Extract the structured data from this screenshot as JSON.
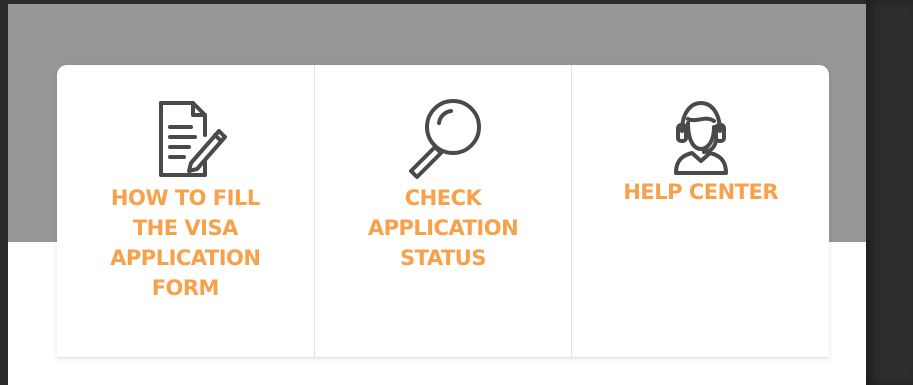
{
  "cards": [
    {
      "label": "HOW TO FILL\nTHE VISA\nAPPLICATION\nFORM",
      "icon": "document-edit-icon"
    },
    {
      "label": "CHECK\nAPPLICATION\nSTATUS",
      "icon": "magnifier-icon"
    },
    {
      "label": "HELP CENTER",
      "icon": "support-agent-icon"
    }
  ],
  "colors": {
    "accent": "#f7a14a",
    "icon": "#4a4a4a",
    "band": "#979797"
  }
}
